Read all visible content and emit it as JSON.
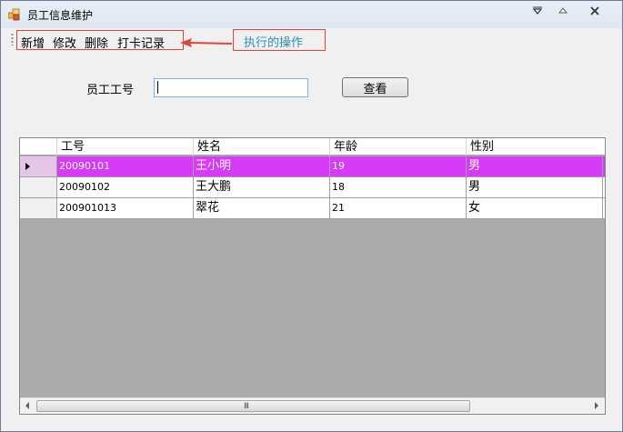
{
  "window": {
    "title": "员工信息维护"
  },
  "menu": {
    "items": [
      {
        "label": "新增"
      },
      {
        "label": "修改"
      },
      {
        "label": "删除"
      },
      {
        "label": "打卡记录"
      }
    ]
  },
  "annotation": {
    "text": "执行的操作"
  },
  "search": {
    "label": "员工工号",
    "value": "",
    "button_label": "查看"
  },
  "grid": {
    "columns": [
      "工号",
      "姓名",
      "年龄",
      "性别"
    ],
    "rows": [
      {
        "id": "20090101",
        "name": "王小明",
        "age": "19",
        "gender": "男",
        "selected": true
      },
      {
        "id": "20090102",
        "name": "王大鹏",
        "age": "18",
        "gender": "男",
        "selected": false
      },
      {
        "id": "200901013",
        "name": "翠花",
        "age": "21",
        "gender": "女",
        "selected": false
      }
    ],
    "scrollbar_grip": "III"
  },
  "colors": {
    "selected_row": "#d63bf7",
    "annotation_border": "#e0443a",
    "annotation_text": "#2b8fb5"
  }
}
